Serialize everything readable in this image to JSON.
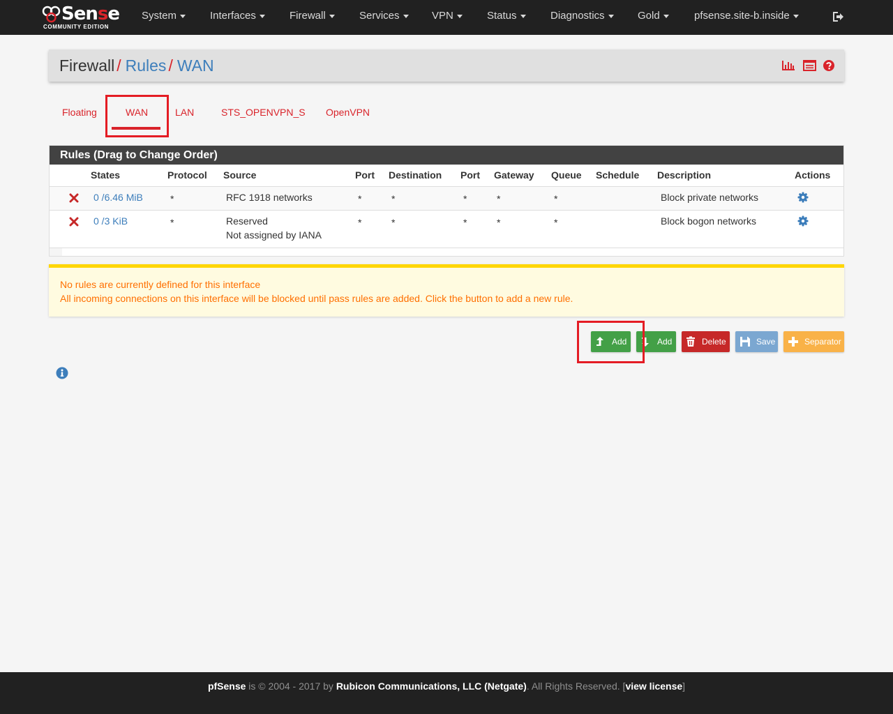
{
  "navbar": {
    "logo_main_a": "Sen",
    "logo_main_b": "s",
    "logo_main_c": "e",
    "logo_sub": "COMMUNITY EDITION",
    "menus": [
      "System",
      "Interfaces",
      "Firewall",
      "Services",
      "VPN",
      "Status",
      "Diagnostics",
      "Gold",
      "pfsense.site-b.inside"
    ]
  },
  "breadcrumb": {
    "part1": "Firewall",
    "sep": "/",
    "part2": "Rules",
    "part3": "WAN"
  },
  "tabs": [
    "Floating",
    "WAN",
    "LAN",
    "STS_OPENVPN_S",
    "OpenVPN"
  ],
  "rules_panel": {
    "title": "Rules (Drag to Change Order)",
    "columns": [
      "States",
      "Protocol",
      "Source",
      "Port",
      "Destination",
      "Port",
      "Gateway",
      "Queue",
      "Schedule",
      "Description",
      "Actions"
    ],
    "rows": [
      {
        "states": "0 /6.46 MiB",
        "protocol": "*",
        "source": "RFC 1918 networks",
        "source2": "",
        "port": "*",
        "destination": "*",
        "dport": "*",
        "gateway": "*",
        "queue": "*",
        "schedule": "",
        "description": "Block private networks"
      },
      {
        "states": "0 /3 KiB",
        "protocol": "*",
        "source": "Reserved",
        "source2": "Not assigned by IANA",
        "port": "*",
        "destination": "*",
        "dport": "*",
        "gateway": "*",
        "queue": "*",
        "schedule": "",
        "description": "Block bogon networks"
      }
    ]
  },
  "warning": {
    "line1": "No rules are currently defined for this interface",
    "line2": "All incoming connections on this interface will be blocked until pass rules are added. Click the button to add a new rule."
  },
  "buttons": {
    "add_top": "Add",
    "add_bottom": "Add",
    "delete": "Delete",
    "save": "Save",
    "separator": "Separator"
  },
  "footer": {
    "brand": "pfSense",
    "text1": " is © 2004 - 2017 by ",
    "company": "Rubicon Communications, LLC (Netgate)",
    "text2": ". All Rights Reserved. [",
    "license": "view license",
    "text3": "]"
  },
  "colors": {
    "navbar": "#212121",
    "accent_red": "#d9232a",
    "link_blue": "#3d7ebb",
    "warning_text": "#ff6f00",
    "warning_border": "#ffd600",
    "green": "#43a047"
  }
}
